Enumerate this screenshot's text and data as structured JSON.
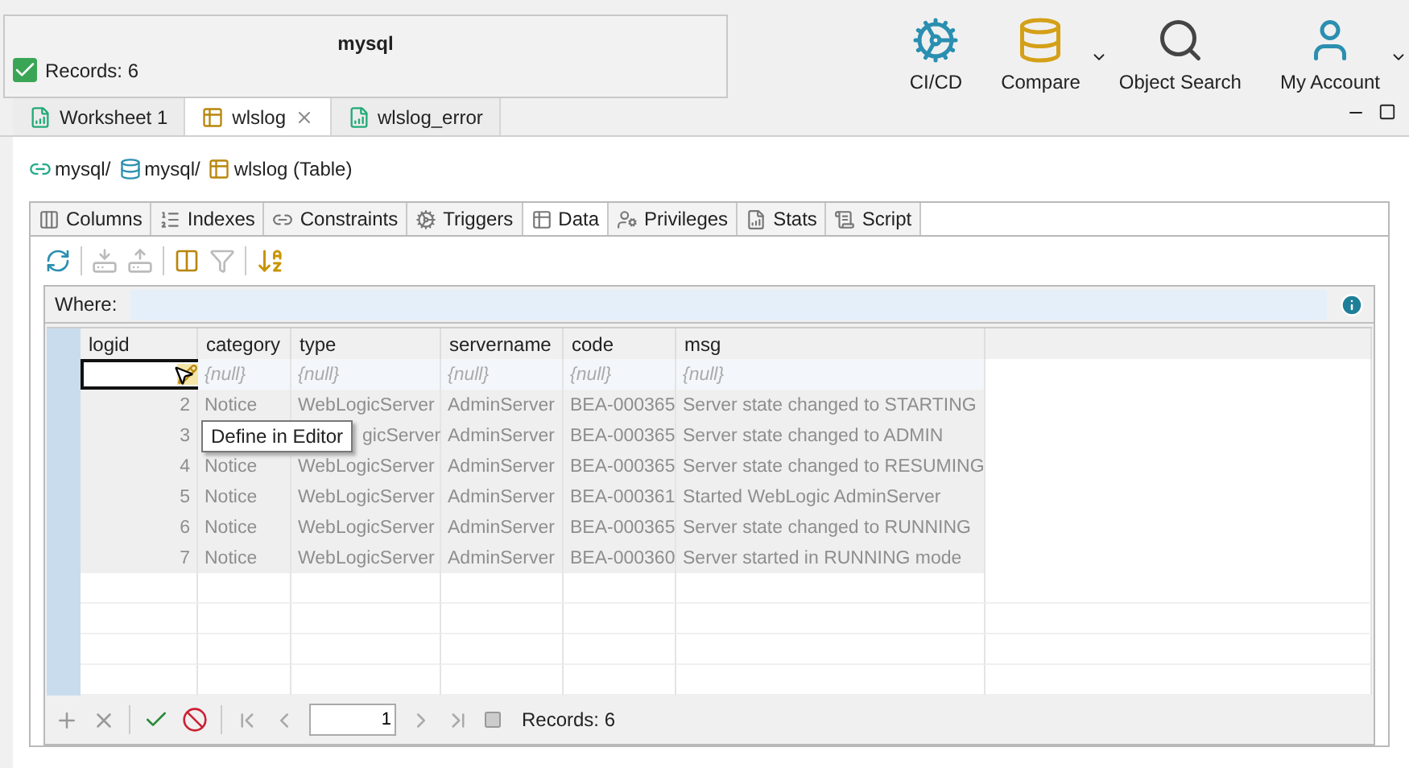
{
  "status_panel": {
    "title": "mysql",
    "status": "Records: 6",
    "ok": true
  },
  "toolbar": [
    {
      "kind": "cicd",
      "label": "CI/CD",
      "dropdown": false
    },
    {
      "kind": "compare",
      "label": "Compare",
      "dropdown": true
    },
    {
      "kind": "search",
      "label": "Object Search",
      "dropdown": false
    },
    {
      "kind": "account",
      "label": "My Account",
      "dropdown": true
    }
  ],
  "editor_tabs": [
    {
      "kind": "sql",
      "label": "Worksheet 1",
      "selected": false,
      "closable": false
    },
    {
      "kind": "table",
      "label": "wlslog",
      "selected": true,
      "closable": true
    },
    {
      "kind": "sql",
      "label": "wlslog_error",
      "selected": false,
      "closable": false
    }
  ],
  "breadcrumb": [
    {
      "kind": "connection",
      "label": "mysql/"
    },
    {
      "kind": "database",
      "label": "mysql/"
    },
    {
      "kind": "table",
      "label": "wlslog (Table)"
    }
  ],
  "object_tabs": [
    {
      "kind": "columns",
      "label": "Columns",
      "selected": false
    },
    {
      "kind": "indexes",
      "label": "Indexes",
      "selected": false
    },
    {
      "kind": "constraints",
      "label": "Constraints",
      "selected": false
    },
    {
      "kind": "triggers",
      "label": "Triggers",
      "selected": false
    },
    {
      "kind": "data",
      "label": "Data",
      "selected": true
    },
    {
      "kind": "privileges",
      "label": "Privileges",
      "selected": false
    },
    {
      "kind": "stats",
      "label": "Stats",
      "selected": false
    },
    {
      "kind": "script",
      "label": "Script",
      "selected": false
    }
  ],
  "where": {
    "label": "Where:"
  },
  "table": {
    "columns": [
      "logid",
      "category",
      "type",
      "servername",
      "code",
      "msg"
    ],
    "new_row": {
      "values": [
        "{null}",
        "{null}",
        "{null}",
        "{null}",
        "{null}"
      ]
    },
    "rows": [
      {
        "dimmed": true,
        "logid": "2",
        "category": "Notice",
        "type": "WebLogicServer",
        "servername": "AdminServer",
        "code": "BEA-000365",
        "msg": "Server state changed to STARTING"
      },
      {
        "dimmed": true,
        "covered": true,
        "logid": "3",
        "type": "gicServer",
        "servername": "AdminServer",
        "code": "BEA-000365",
        "msg": "Server state changed to ADMIN"
      },
      {
        "dimmed": true,
        "logid": "4",
        "category": "Notice",
        "type": "WebLogicServer",
        "servername": "AdminServer",
        "code": "BEA-000365",
        "msg": "Server state changed to RESUMING"
      },
      {
        "dimmed": true,
        "logid": "5",
        "category": "Notice",
        "type": "WebLogicServer",
        "servername": "AdminServer",
        "code": "BEA-000361",
        "msg": "Started WebLogic AdminServer"
      },
      {
        "dimmed": true,
        "logid": "6",
        "category": "Notice",
        "type": "WebLogicServer",
        "servername": "AdminServer",
        "code": "BEA-000365",
        "msg": "Server state changed to RUNNING"
      },
      {
        "dimmed": true,
        "logid": "7",
        "category": "Notice",
        "type": "WebLogicServer",
        "servername": "AdminServer",
        "code": "BEA-000360",
        "msg": "Server started in RUNNING mode"
      }
    ]
  },
  "tooltip": "Define in Editor",
  "pager": {
    "page": "1",
    "records": "Records: 6"
  }
}
